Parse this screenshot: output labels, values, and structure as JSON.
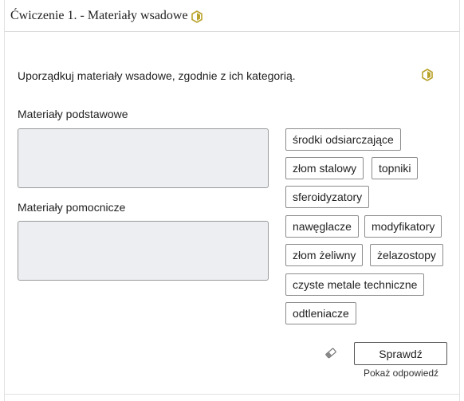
{
  "exercise": {
    "title": "Ćwiczenie 1. - Materiały wsadowe",
    "level_icon": "hexagon-level-icon",
    "instruction": "Uporządkuj materiały wsadowe, zgodnie z ich kategorią."
  },
  "categories": [
    {
      "label": "Materiały podstawowe"
    },
    {
      "label": "Materiały pomocnicze"
    }
  ],
  "items": [
    "środki odsiarczające",
    "złom stalowy",
    "topniki",
    "sferoidyzatory",
    "nawęglacze",
    "modyfikatory",
    "złom żeliwny",
    "żelazostopy",
    "czyste metale techniczne",
    "odtleniacze"
  ],
  "actions": {
    "reset_icon": "eraser-icon",
    "check_label": "Sprawdź",
    "show_answer_label": "Pokaż odpowiedź"
  },
  "colors": {
    "hex_icon_gold": "#b9a22a",
    "drop_zone_bg": "#eceef2"
  }
}
